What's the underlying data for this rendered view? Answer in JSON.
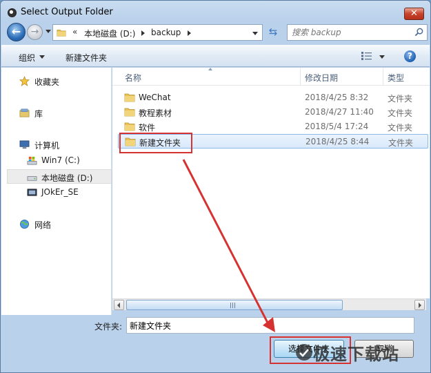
{
  "window": {
    "title": "Select Output Folder"
  },
  "navigation": {
    "breadcrumb_prefix": "«",
    "breadcrumb": [
      "本地磁盘 (D:)",
      "backup"
    ],
    "search_placeholder": "搜索 backup"
  },
  "toolbar": {
    "organize_label": "组织",
    "new_folder_label": "新建文件夹"
  },
  "sidebar": {
    "favorites": "收藏夹",
    "libraries": "库",
    "computer": "计算机",
    "drives": [
      "Win7 (C:)",
      "本地磁盘 (D:)",
      "JOkEr_SE"
    ],
    "network": "网络"
  },
  "file_list": {
    "columns": {
      "name": "名称",
      "date": "修改日期",
      "type": "类型"
    },
    "rows": [
      {
        "name": "WeChat",
        "date": "2018/4/25 8:32",
        "type": "文件夹"
      },
      {
        "name": "教程素材",
        "date": "2018/4/27 11:40",
        "type": "文件夹"
      },
      {
        "name": "软件",
        "date": "2018/5/4 17:24",
        "type": "文件夹"
      },
      {
        "name": "新建文件夹",
        "date": "2018/4/25 8:44",
        "type": "文件夹"
      }
    ],
    "selected_row": 3
  },
  "folder_field": {
    "label": "文件夹:",
    "value": "新建文件夹"
  },
  "buttons": {
    "select_folder": "选择文件夹",
    "cancel": "取消"
  },
  "watermark": "极速下载站",
  "colors": {
    "highlight_red": "#d63232",
    "selection_blue": "#d9e9fb",
    "frame_blue": "#b9d1ea"
  }
}
